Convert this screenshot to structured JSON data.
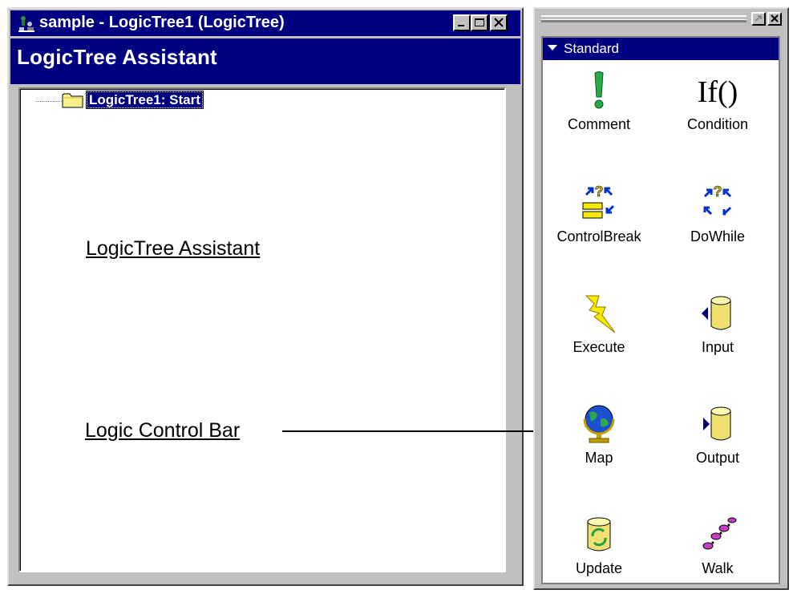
{
  "window": {
    "title": "sample - LogicTree1 (LogicTree)",
    "header": "LogicTree Assistant",
    "tree": {
      "root_label": "LogicTree1: Start"
    }
  },
  "annotations": {
    "assistant": "LogicTree Assistant",
    "control_bar": "Logic Control Bar"
  },
  "control_bar": {
    "section": "Standard",
    "tools": [
      {
        "label": "Comment",
        "icon": "exclamation-icon"
      },
      {
        "label": "Condition",
        "icon": "if-icon"
      },
      {
        "label": "ControlBreak",
        "icon": "control-break-icon"
      },
      {
        "label": "DoWhile",
        "icon": "do-while-icon"
      },
      {
        "label": "Execute",
        "icon": "lightning-icon"
      },
      {
        "label": "Input",
        "icon": "input-cylinder-icon"
      },
      {
        "label": "Map",
        "icon": "globe-icon"
      },
      {
        "label": "Output",
        "icon": "output-cylinder-icon"
      },
      {
        "label": "Update",
        "icon": "update-icon"
      },
      {
        "label": "Walk",
        "icon": "footprints-icon"
      }
    ]
  },
  "colors": {
    "title_bar": "#000080",
    "face": "#c0c0c0",
    "selection": "#000080"
  }
}
